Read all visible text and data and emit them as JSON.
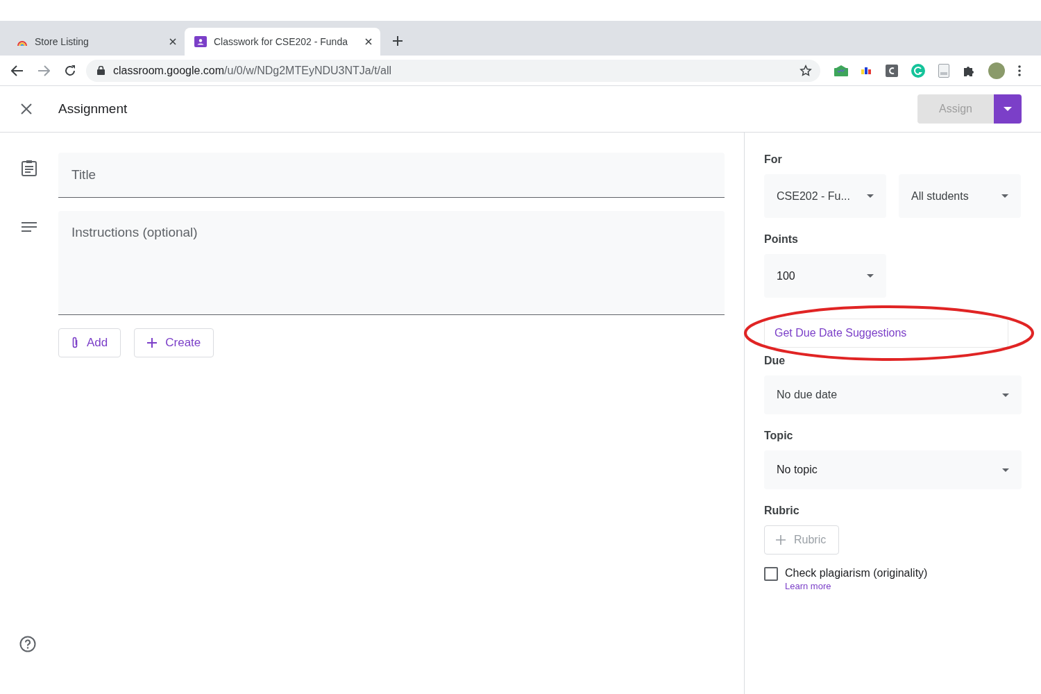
{
  "tabs": [
    {
      "label": "Store Listing",
      "selected": false
    },
    {
      "label": "Classwork for CSE202 - Funda",
      "selected": true
    }
  ],
  "address": {
    "host": "classroom.google.com",
    "path": "/u/0/w/NDg2MTEyNDU3NTJa/t/all"
  },
  "header": {
    "title": "Assignment",
    "assign": {
      "label": "Assign",
      "disabled": true
    }
  },
  "form": {
    "title_placeholder": "Title",
    "instructions_placeholder": "Instructions (optional)",
    "buttons": [
      {
        "label": "Add",
        "kind": "clip"
      },
      {
        "label": "Create",
        "kind": "plus"
      }
    ]
  },
  "side": {
    "for_label": "For",
    "class_value": "CSE202 - Fu...",
    "students_value": "All students",
    "points_label": "Points",
    "points_value": "100",
    "suggest_link": "Get Due Date Suggestions",
    "due_label": "Due",
    "due_value": "No due date",
    "topic_label": "Topic",
    "topic_value": "No topic",
    "rubric_label": "Rubric",
    "rubric_button": {
      "label": "Rubric",
      "disabled": true
    },
    "plagiarism": {
      "label": "Check plagiarism (originality)",
      "checked": false,
      "link": "Learn more"
    }
  }
}
